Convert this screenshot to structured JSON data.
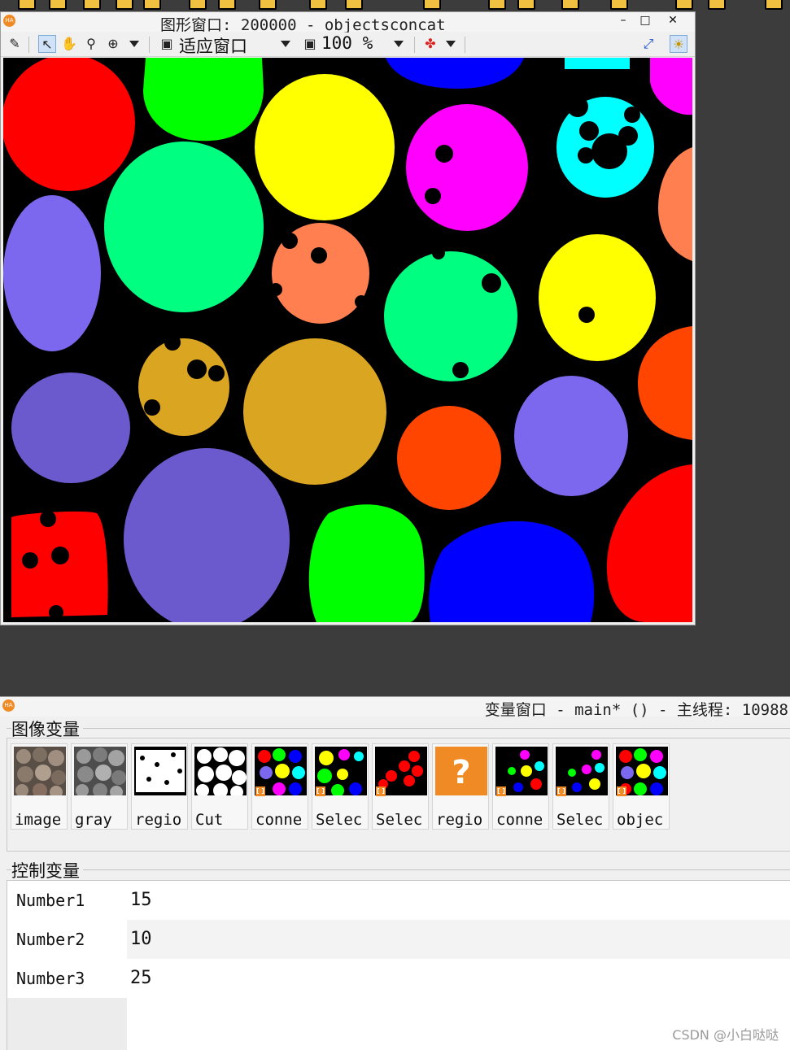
{
  "graphics_window": {
    "title": "图形窗口: 200000 - objectsconcat",
    "logo_text": "HA",
    "minimize_glyph": "–",
    "maximize_glyph": "□",
    "close_glyph": "✕",
    "toolbar": {
      "fit_window_label": "适应窗口",
      "zoom_value": "100 %",
      "icons": [
        "edit-icon",
        "pointer-icon",
        "hand-icon",
        "zoom-icon",
        "zoom-plus-icon",
        "fit-window-icon",
        "zoom-percent-icon",
        "color-icon",
        "axis-icon",
        "lightbulb-icon"
      ]
    },
    "image_description_colors": [
      "#ff0000",
      "#00ff00",
      "#ffff00",
      "#0000ff",
      "#00ffff",
      "#ff00ff",
      "#ff8080",
      "#00ff80",
      "#7b68ee",
      "#daa520",
      "#ff4500",
      "#6a5acd",
      "#ff7f50"
    ]
  },
  "variable_window": {
    "title": "变量窗口 - main* () - 主线程: 10988",
    "logo_text": "HA",
    "image_vars_label": "图像变量",
    "control_vars_label": "控制变量",
    "image_vars": [
      {
        "label": "image",
        "kind": "photo-color"
      },
      {
        "label": "gray",
        "kind": "photo-gray"
      },
      {
        "label": "regio",
        "kind": "region-white"
      },
      {
        "label": "Cut",
        "kind": "region-white"
      },
      {
        "label": "conne",
        "kind": "objects"
      },
      {
        "label": "Selec",
        "kind": "objects"
      },
      {
        "label": "Selec",
        "kind": "objects-red"
      },
      {
        "label": "regio",
        "kind": "unknown"
      },
      {
        "label": "conne",
        "kind": "objects-sparse"
      },
      {
        "label": "Selec",
        "kind": "objects-sparse"
      },
      {
        "label": "objec",
        "kind": "objects"
      }
    ],
    "unknown_glyph": "?",
    "object_badge": "[ ]",
    "control_vars": [
      {
        "name": "Number1",
        "value": "15"
      },
      {
        "name": "Number2",
        "value": "10"
      },
      {
        "name": "Number3",
        "value": "25"
      }
    ]
  },
  "watermark": "CSDN @小白哒哒"
}
